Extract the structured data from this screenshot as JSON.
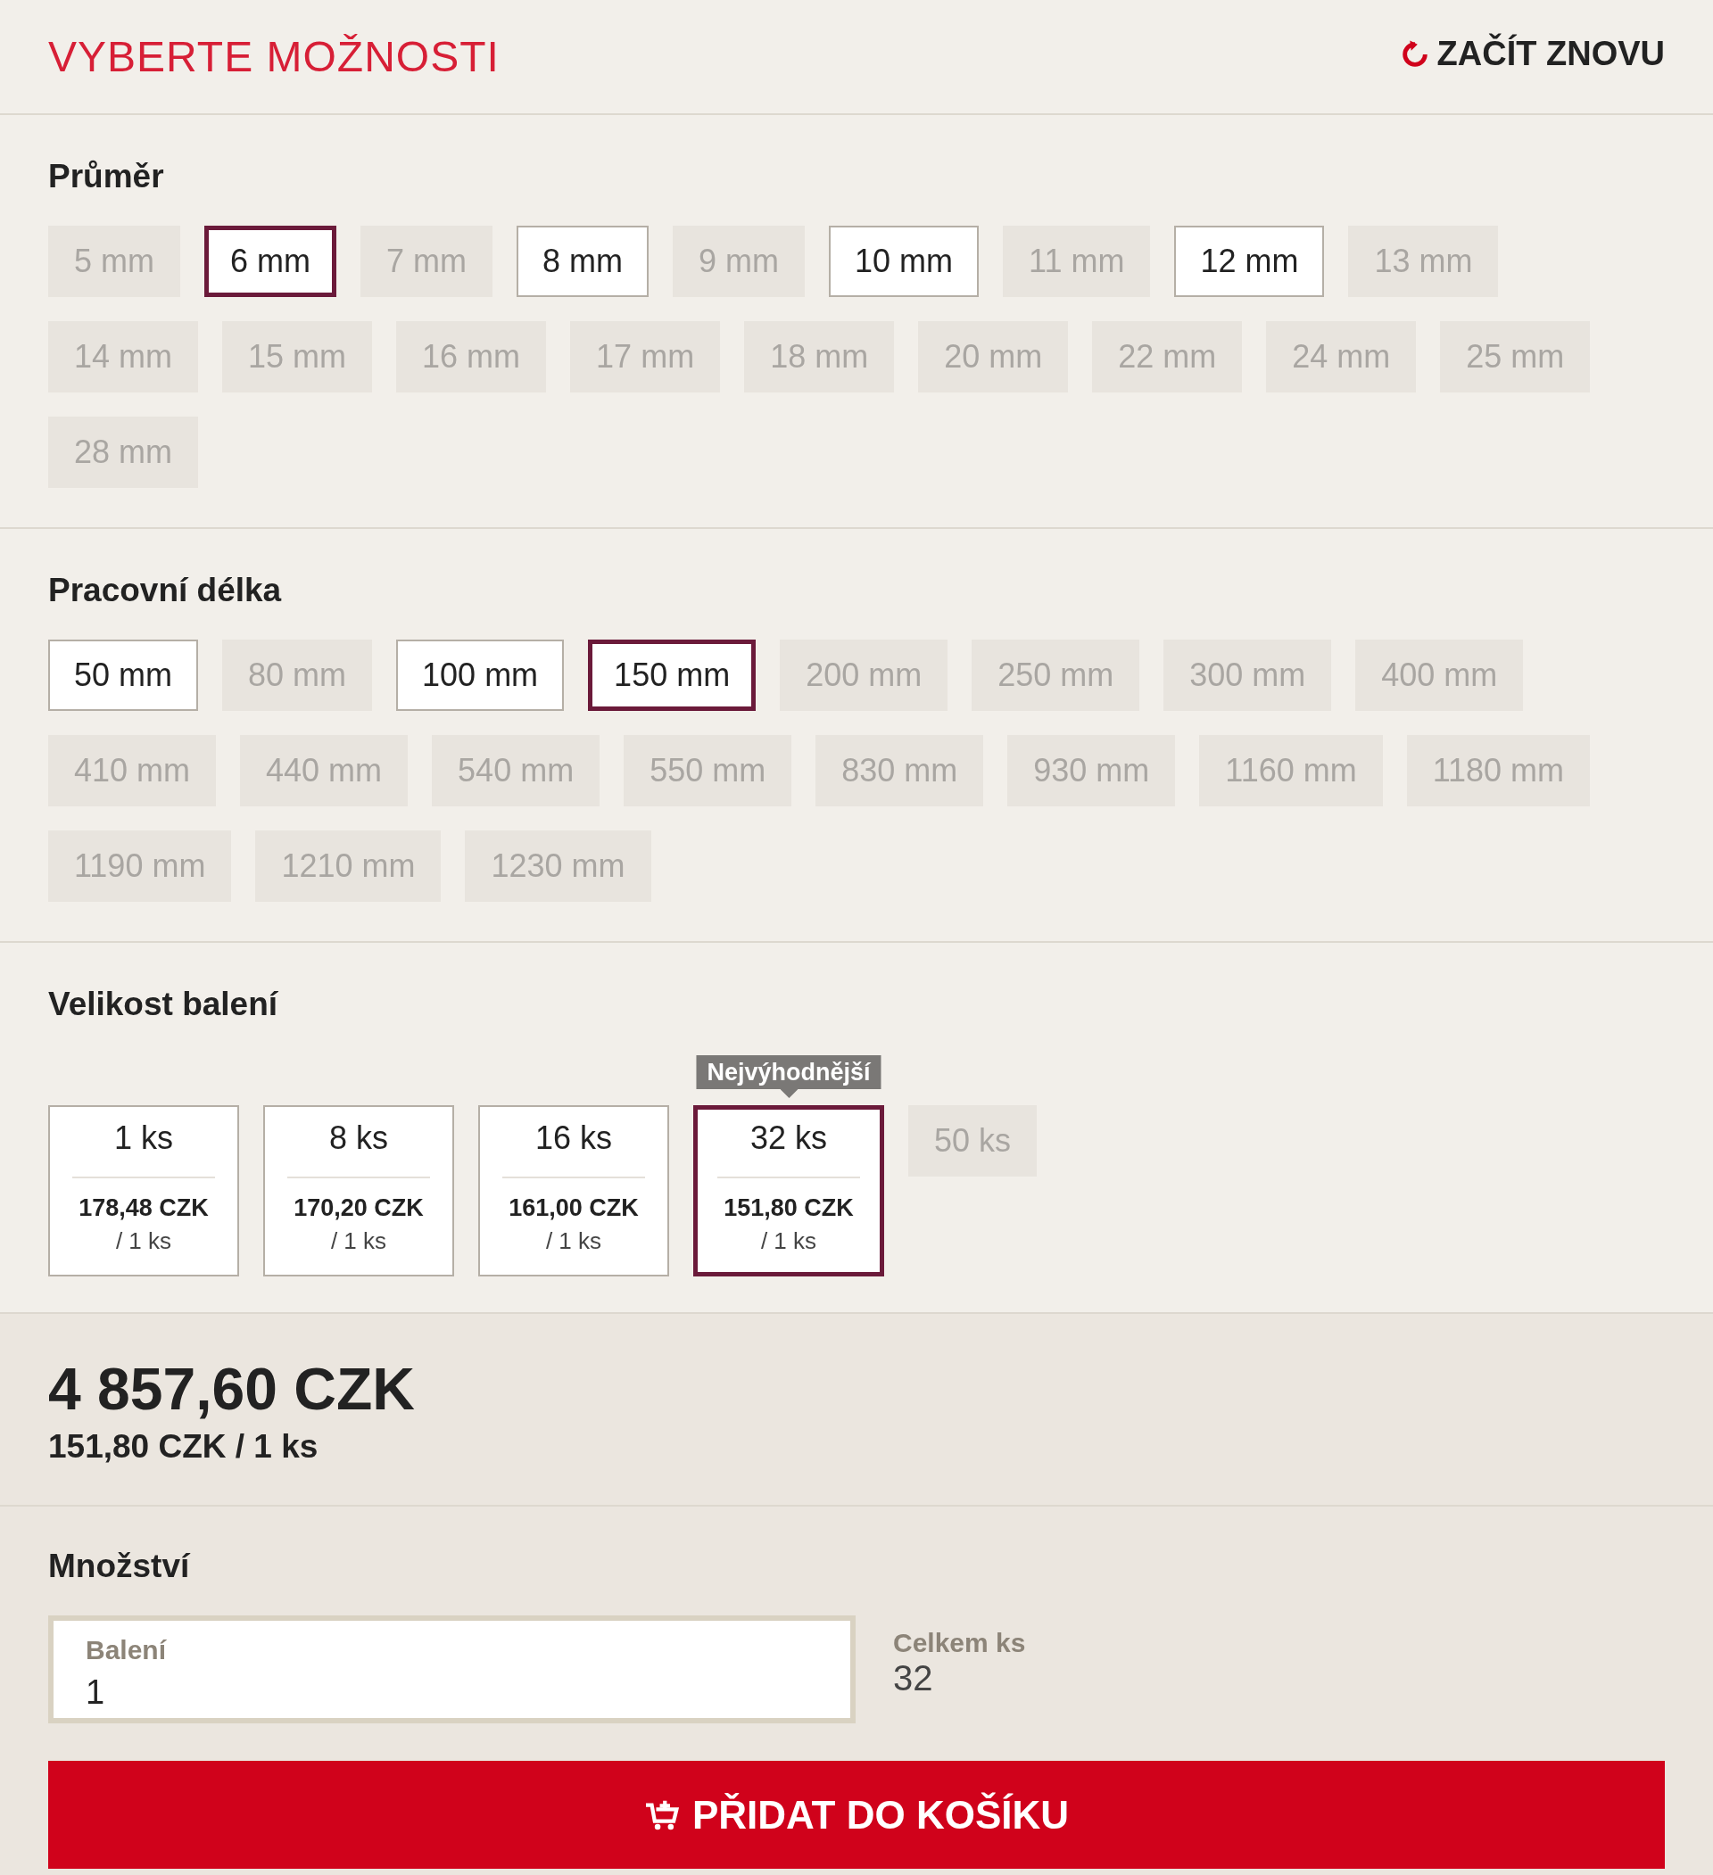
{
  "header": {
    "title": "VYBERTE MOŽNOSTI",
    "reset": "ZAČÍT ZNOVU"
  },
  "sections": [
    {
      "title": "Průměr",
      "options": [
        {
          "label": "5 mm",
          "available": false,
          "selected": false
        },
        {
          "label": "6 mm",
          "available": true,
          "selected": true
        },
        {
          "label": "7 mm",
          "available": false,
          "selected": false
        },
        {
          "label": "8 mm",
          "available": true,
          "selected": false
        },
        {
          "label": "9 mm",
          "available": false,
          "selected": false
        },
        {
          "label": "10 mm",
          "available": true,
          "selected": false
        },
        {
          "label": "11 mm",
          "available": false,
          "selected": false
        },
        {
          "label": "12 mm",
          "available": true,
          "selected": false
        },
        {
          "label": "13 mm",
          "available": false,
          "selected": false
        },
        {
          "label": "14 mm",
          "available": false,
          "selected": false
        },
        {
          "label": "15 mm",
          "available": false,
          "selected": false
        },
        {
          "label": "16 mm",
          "available": false,
          "selected": false
        },
        {
          "label": "17 mm",
          "available": false,
          "selected": false
        },
        {
          "label": "18 mm",
          "available": false,
          "selected": false
        },
        {
          "label": "20 mm",
          "available": false,
          "selected": false
        },
        {
          "label": "22 mm",
          "available": false,
          "selected": false
        },
        {
          "label": "24 mm",
          "available": false,
          "selected": false
        },
        {
          "label": "25 mm",
          "available": false,
          "selected": false
        },
        {
          "label": "28 mm",
          "available": false,
          "selected": false
        }
      ]
    },
    {
      "title": "Pracovní délka",
      "options": [
        {
          "label": "50 mm",
          "available": true,
          "selected": false
        },
        {
          "label": "80 mm",
          "available": false,
          "selected": false
        },
        {
          "label": "100 mm",
          "available": true,
          "selected": false
        },
        {
          "label": "150 mm",
          "available": true,
          "selected": true
        },
        {
          "label": "200 mm",
          "available": false,
          "selected": false
        },
        {
          "label": "250 mm",
          "available": false,
          "selected": false
        },
        {
          "label": "300 mm",
          "available": false,
          "selected": false
        },
        {
          "label": "400 mm",
          "available": false,
          "selected": false
        },
        {
          "label": "410 mm",
          "available": false,
          "selected": false
        },
        {
          "label": "440 mm",
          "available": false,
          "selected": false
        },
        {
          "label": "540 mm",
          "available": false,
          "selected": false
        },
        {
          "label": "550 mm",
          "available": false,
          "selected": false
        },
        {
          "label": "830 mm",
          "available": false,
          "selected": false
        },
        {
          "label": "930 mm",
          "available": false,
          "selected": false
        },
        {
          "label": "1160 mm",
          "available": false,
          "selected": false
        },
        {
          "label": "1180 mm",
          "available": false,
          "selected": false
        },
        {
          "label": "1190 mm",
          "available": false,
          "selected": false
        },
        {
          "label": "1210 mm",
          "available": false,
          "selected": false
        },
        {
          "label": "1230 mm",
          "available": false,
          "selected": false
        }
      ]
    }
  ],
  "packaging": {
    "title": "Velikost balení",
    "options": [
      {
        "label": "1 ks",
        "price": "178,48 CZK",
        "unit": "/ 1 ks",
        "available": true,
        "selected": false
      },
      {
        "label": "8 ks",
        "price": "170,20 CZK",
        "unit": "/ 1 ks",
        "available": true,
        "selected": false
      },
      {
        "label": "16 ks",
        "price": "161,00 CZK",
        "unit": "/ 1 ks",
        "available": true,
        "selected": false
      },
      {
        "label": "32 ks",
        "price": "151,80 CZK",
        "unit": "/ 1 ks",
        "badge": "Nejvýhodnější",
        "available": true,
        "selected": true
      },
      {
        "label": "50 ks",
        "available": false,
        "selected": false
      }
    ]
  },
  "total": {
    "price": "4 857,60 CZK",
    "unit_price": "151,80 CZK / 1 ks"
  },
  "quantity": {
    "title": "Množství",
    "packs": {
      "label": "Balení",
      "value": "1"
    },
    "pieces": {
      "label": "Celkem ks",
      "value": "32"
    }
  },
  "add_to_cart": "PŘIDAT DO KOŠÍKU"
}
